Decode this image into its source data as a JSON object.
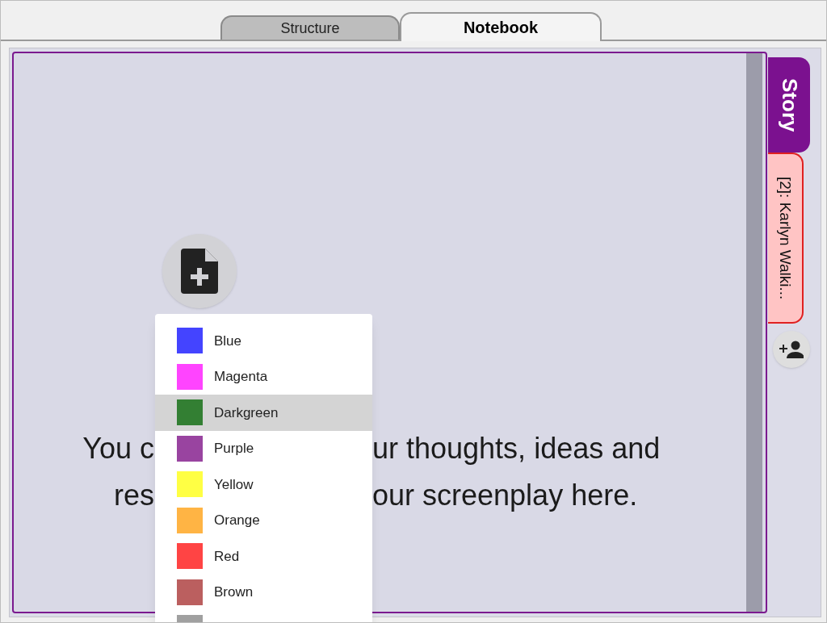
{
  "top_tabs": [
    {
      "label": "Structure",
      "selected": false
    },
    {
      "label": "Notebook",
      "selected": true
    }
  ],
  "side_tabs": [
    {
      "label": "Story",
      "selected": true
    },
    {
      "label": "[2]: Karlyn Walki...",
      "selected": false
    }
  ],
  "notebook": {
    "text_lines": [
      {
        "left": "You c",
        "right": "ur thoughts, ideas and"
      },
      {
        "left": "res",
        "right": "our screenplay here."
      }
    ]
  },
  "color_menu": [
    {
      "label": "Blue",
      "color": "#4444ff",
      "selected": false
    },
    {
      "label": "Magenta",
      "color": "#ff44ff",
      "selected": false
    },
    {
      "label": "Darkgreen",
      "color": "#337f33",
      "selected": true
    },
    {
      "label": "Purple",
      "color": "#9944a0",
      "selected": false
    },
    {
      "label": "Yellow",
      "color": "#ffff44",
      "selected": false
    },
    {
      "label": "Orange",
      "color": "#ffb444",
      "selected": false
    },
    {
      "label": "Red",
      "color": "#ff4444",
      "selected": false
    },
    {
      "label": "Brown",
      "color": "#bb5f5f",
      "selected": false
    },
    {
      "color": "#a0a0a0",
      "selected": false
    }
  ]
}
